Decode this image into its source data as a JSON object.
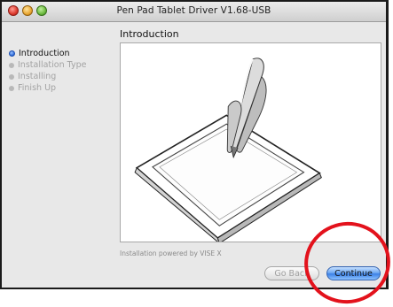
{
  "window": {
    "title": "Pen Pad Tablet Driver V1.68-USB"
  },
  "sidebar": {
    "steps": [
      {
        "label": "Introduction",
        "state": "current"
      },
      {
        "label": "Installation Type",
        "state": "pending"
      },
      {
        "label": "Installing",
        "state": "pending"
      },
      {
        "label": "Finish Up",
        "state": "pending"
      }
    ]
  },
  "main": {
    "heading": "Introduction",
    "illustration": "pen-tablet-illustration"
  },
  "footer": {
    "powered_by": "Installation powered by VISE X",
    "back_label": "Go Back",
    "continue_label": "Continue"
  },
  "annotation": {
    "color": "#e3121c",
    "target": "continue-button"
  },
  "colors": {
    "accent": "#3b80e6",
    "close": "#dc3a2e",
    "minimize": "#e9a733",
    "zoom": "#6cba3f"
  }
}
